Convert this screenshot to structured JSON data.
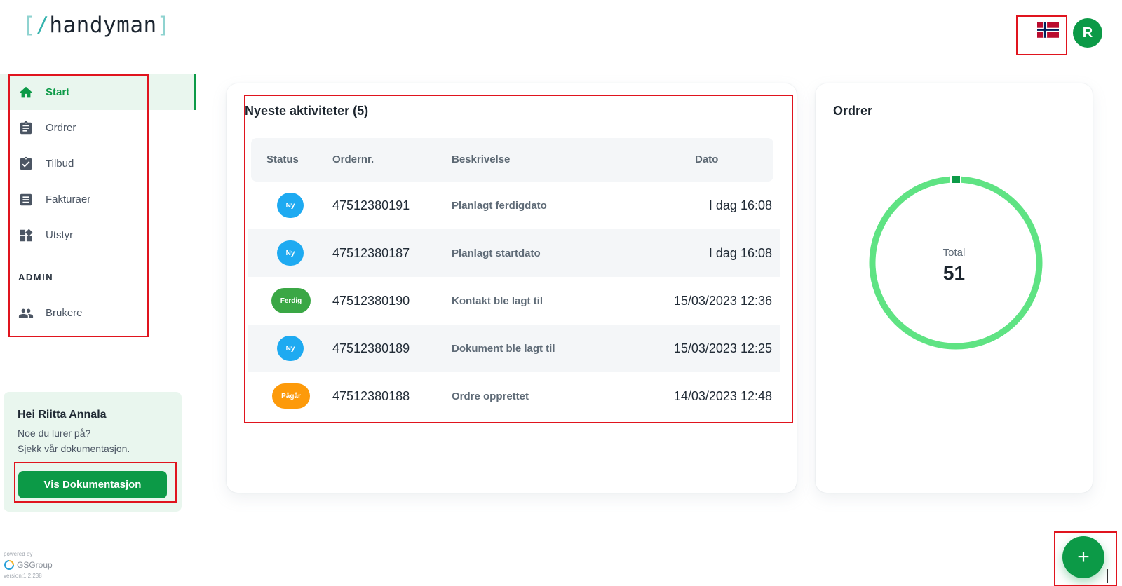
{
  "logo": {
    "open_bracket": "[",
    "slash": "/",
    "name": "handyman",
    "close_bracket": "]"
  },
  "nav": {
    "items": [
      {
        "label": "Start",
        "icon": "home-icon",
        "active": true
      },
      {
        "label": "Ordrer",
        "icon": "clipboard-icon"
      },
      {
        "label": "Tilbud",
        "icon": "clipboard-check-icon"
      },
      {
        "label": "Fakturaer",
        "icon": "invoice-icon"
      },
      {
        "label": "Utstyr",
        "icon": "widgets-icon"
      }
    ],
    "section_label": "ADMIN",
    "admin_items": [
      {
        "label": "Brukere",
        "icon": "users-icon"
      }
    ]
  },
  "help": {
    "greeting": "Hei Riitta Annala",
    "line1": "Noe du lurer på?",
    "line2": "Sjekk vår dokumentasjon.",
    "button": "Vis Dokumentasjon"
  },
  "footer": {
    "powered": "powered by",
    "brand": "GSGroup",
    "version": "version:1.2.238"
  },
  "header": {
    "language": "norwegian-flag-icon",
    "avatar_initial": "R"
  },
  "activities": {
    "title": "Nyeste aktiviteter (5)",
    "columns": [
      "Status",
      "Ordernr.",
      "Beskrivelse",
      "Dato"
    ],
    "rows": [
      {
        "status": "Ny",
        "status_color": "#1eaaf1",
        "ordernr": "47512380191",
        "desc": "Planlagt ferdigdato",
        "dato": "I dag 16:08"
      },
      {
        "status": "Ny",
        "status_color": "#1eaaf1",
        "ordernr": "47512380187",
        "desc": "Planlagt startdato",
        "dato": "I dag 16:08"
      },
      {
        "status": "Ferdig",
        "status_color": "#3aa745",
        "ordernr": "47512380190",
        "desc": "Kontakt ble lagt til",
        "dato": "15/03/2023 12:36"
      },
      {
        "status": "Ny",
        "status_color": "#1eaaf1",
        "ordernr": "47512380189",
        "desc": "Dokument ble lagt til",
        "dato": "15/03/2023 12:25"
      },
      {
        "status": "Pågår",
        "status_color": "#fd9a0a",
        "ordernr": "47512380188",
        "desc": "Ordre opprettet",
        "dato": "14/03/2023 12:48"
      }
    ]
  },
  "orders": {
    "title": "Ordrer",
    "total_label": "Total",
    "total_value": "51",
    "ring_color": "#5fe383",
    "accent_color": "#0c9a47"
  },
  "fab": {
    "label": "+"
  },
  "colors": {
    "brand": "#0c9a47",
    "highlight": "#e0141e"
  }
}
